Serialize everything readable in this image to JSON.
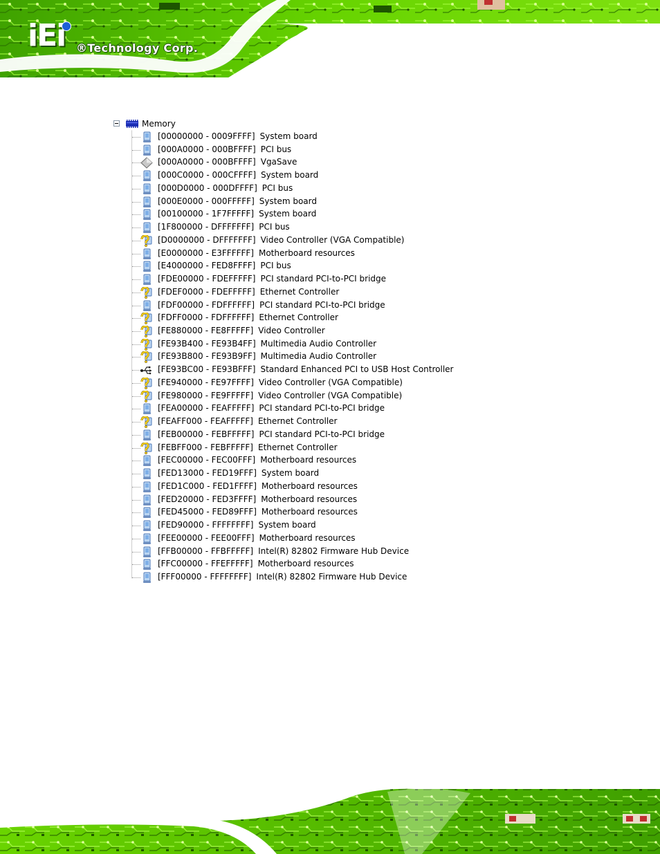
{
  "header": {
    "logo_mark": "iEi",
    "logo_text": "®Technology Corp."
  },
  "tree": {
    "root_label": "Memory",
    "items": [
      {
        "range": "[00000000 - 0009FFFF]",
        "desc": "System board",
        "icon": "monitor-icon"
      },
      {
        "range": "[000A0000 - 000BFFFF]",
        "desc": "PCI bus",
        "icon": "monitor-icon"
      },
      {
        "range": "[000A0000 - 000BFFFF]",
        "desc": "VgaSave",
        "icon": "diamond-icon"
      },
      {
        "range": "[000C0000 - 000CFFFF]",
        "desc": "System board",
        "icon": "monitor-icon"
      },
      {
        "range": "[000D0000 - 000DFFFF]",
        "desc": "PCI bus",
        "icon": "monitor-icon"
      },
      {
        "range": "[000E0000 - 000FFFFF]",
        "desc": "System board",
        "icon": "monitor-icon"
      },
      {
        "range": "[00100000 - 1F7FFFFF]",
        "desc": "System board",
        "icon": "monitor-icon"
      },
      {
        "range": "[1F800000 - DFFFFFFF]",
        "desc": "PCI bus",
        "icon": "monitor-icon"
      },
      {
        "range": "[D0000000 - DFFFFFFF]",
        "desc": "Video Controller (VGA Compatible)",
        "icon": "unknown-device-icon"
      },
      {
        "range": "[E0000000 - E3FFFFFF]",
        "desc": "Motherboard resources",
        "icon": "monitor-icon"
      },
      {
        "range": "[E4000000 - FED8FFFF]",
        "desc": "PCI bus",
        "icon": "monitor-icon"
      },
      {
        "range": "[FDE00000 - FDEFFFFF]",
        "desc": "PCI standard PCI-to-PCI bridge",
        "icon": "monitor-icon"
      },
      {
        "range": "[FDEF0000 - FDEFFFFF]",
        "desc": "Ethernet Controller",
        "icon": "unknown-device-icon"
      },
      {
        "range": "[FDF00000 - FDFFFFFF]",
        "desc": "PCI standard PCI-to-PCI bridge",
        "icon": "monitor-icon"
      },
      {
        "range": "[FDFF0000 - FDFFFFFF]",
        "desc": "Ethernet Controller",
        "icon": "unknown-device-icon"
      },
      {
        "range": "[FE880000 - FE8FFFFF]",
        "desc": "Video Controller",
        "icon": "unknown-device-icon"
      },
      {
        "range": "[FE93B400 - FE93B4FF]",
        "desc": "Multimedia Audio Controller",
        "icon": "unknown-device-icon"
      },
      {
        "range": "[FE93B800 - FE93B9FF]",
        "desc": "Multimedia Audio Controller",
        "icon": "unknown-device-icon"
      },
      {
        "range": "[FE93BC00 - FE93BFFF]",
        "desc": "Standard Enhanced PCI to USB Host Controller",
        "icon": "usb-icon"
      },
      {
        "range": "[FE940000 - FE97FFFF]",
        "desc": "Video Controller (VGA Compatible)",
        "icon": "unknown-device-icon"
      },
      {
        "range": "[FE980000 - FE9FFFFF]",
        "desc": "Video Controller (VGA Compatible)",
        "icon": "unknown-device-icon"
      },
      {
        "range": "[FEA00000 - FEAFFFFF]",
        "desc": "PCI standard PCI-to-PCI bridge",
        "icon": "monitor-icon"
      },
      {
        "range": "[FEAFF000 - FEAFFFFF]",
        "desc": "Ethernet Controller",
        "icon": "unknown-device-icon"
      },
      {
        "range": "[FEB00000 - FEBFFFFF]",
        "desc": "PCI standard PCI-to-PCI bridge",
        "icon": "monitor-icon"
      },
      {
        "range": "[FEBFF000 - FEBFFFFF]",
        "desc": "Ethernet Controller",
        "icon": "unknown-device-icon"
      },
      {
        "range": "[FEC00000 - FEC00FFF]",
        "desc": "Motherboard resources",
        "icon": "monitor-icon"
      },
      {
        "range": "[FED13000 - FED19FFF]",
        "desc": "System board",
        "icon": "monitor-icon"
      },
      {
        "range": "[FED1C000 - FED1FFFF]",
        "desc": "Motherboard resources",
        "icon": "monitor-icon"
      },
      {
        "range": "[FED20000 - FED3FFFF]",
        "desc": "Motherboard resources",
        "icon": "monitor-icon"
      },
      {
        "range": "[FED45000 - FED89FFF]",
        "desc": "Motherboard resources",
        "icon": "monitor-icon"
      },
      {
        "range": "[FED90000 - FFFFFFFF]",
        "desc": "System board",
        "icon": "monitor-icon"
      },
      {
        "range": "[FEE00000 - FEE00FFF]",
        "desc": "Motherboard resources",
        "icon": "monitor-icon"
      },
      {
        "range": "[FFB00000 - FFBFFFFF]",
        "desc": "Intel(R) 82802 Firmware Hub Device",
        "icon": "monitor-icon"
      },
      {
        "range": "[FFC00000 - FFEFFFFF]",
        "desc": "Motherboard resources",
        "icon": "monitor-icon"
      },
      {
        "range": "[FFF00000 - FFFFFFFF]",
        "desc": "Intel(R) 82802 Firmware Hub Device",
        "icon": "monitor-icon"
      }
    ]
  },
  "colors": {
    "banner_green": "#5fd000",
    "banner_dark": "#2e7a00",
    "chip_blue": "#1c2fb5"
  }
}
